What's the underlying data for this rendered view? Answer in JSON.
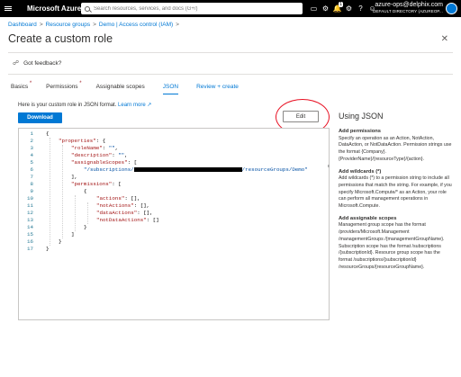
{
  "topbar": {
    "brand": "Microsoft Azure",
    "search_placeholder": "Search resources, services, and docs (G+/)",
    "notifications_badge": "1",
    "account_email": "azure-ops@delphix.com",
    "account_directory": "DEFAULT DIRECTORY (AZUREOP..."
  },
  "breadcrumb": {
    "items": [
      "Dashboard",
      "Resource groups",
      "Demo | Access control (IAM)"
    ],
    "separator": ">"
  },
  "page_title": "Create a custom role",
  "feedback_label": "Got feedback?",
  "tabs": [
    {
      "label": "Basics",
      "required": "*"
    },
    {
      "label": "Permissions",
      "required": "*"
    },
    {
      "label": "Assignable scopes"
    },
    {
      "label": "JSON"
    },
    {
      "label": "Review + create"
    }
  ],
  "intro": {
    "text": "Here is your custom role in JSON format.",
    "link": "Learn more"
  },
  "buttons": {
    "download": "Download",
    "edit": "Edit"
  },
  "editor": {
    "line_numbers": [
      "1",
      "2",
      "3",
      "4",
      "5",
      "6",
      "7",
      "8",
      "9",
      "10",
      "11",
      "12",
      "13",
      "14",
      "15",
      "16",
      "17"
    ],
    "lines": {
      "l1": "{",
      "l2_key": "\"properties\"",
      "l2_rest": ": {",
      "l3_key": "\"roleName\"",
      "l3_val": "\"\"",
      "l4_key": "\"description\"",
      "l4_val": "\"\"",
      "l5_key": "\"assignableScopes\"",
      "l5_rest": ": [",
      "l6_start": "\"/subscriptions/",
      "l6_end": "/resourceGroups/Demo\"",
      "l7": "],",
      "l8_key": "\"permissions\"",
      "l8_rest": ": [",
      "l9": "{",
      "l10_key": "\"actions\"",
      "l10_rest": ": [],",
      "l11_key": "\"notActions\"",
      "l11_rest": ": [],",
      "l12_key": "\"dataActions\"",
      "l12_rest": ": [],",
      "l13_key": "\"notDataActions\"",
      "l13_rest": ": []",
      "l14": "}",
      "l15": "]",
      "l16": "}",
      "l17": "}"
    }
  },
  "help": {
    "title": "Using JSON",
    "sections": [
      {
        "heading": "Add permissions",
        "body": "Specify an operation as an Action, NotAction, DataAction, or NotDataAction. Permission strings use the format {Company}.{ProviderName}/{resourceType}/{action}."
      },
      {
        "heading": "Add wildcards (*)",
        "body": "Add wildcards (*) to a permission string to include all permissions that match the string. For example, if you specify Microsoft.Compute/* as an Action, your role can perform all management operations in Microsoft.Compute."
      },
      {
        "heading": "Add assignable scopes",
        "body": "Management group scope has the format /providers/Microsoft.Management /managementGroups /{managementGroupName}. Subscription scope has the format /subscriptions /{subscriptionId}. Resource group scope has the format /subscriptions/{subscriptionId} /resourceGroups/{resourceGroupName}."
      }
    ]
  }
}
